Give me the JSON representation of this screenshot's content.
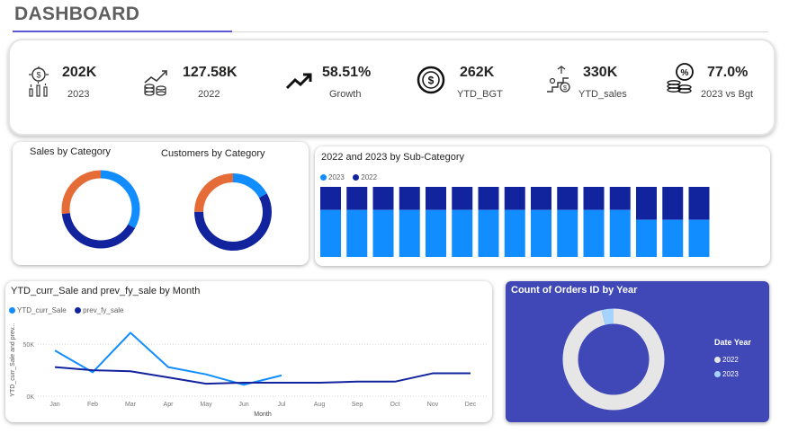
{
  "header": {
    "title": "DASHBOARD"
  },
  "kpis": [
    {
      "value": "202K",
      "label": "2023",
      "icon": "money-growth-icon"
    },
    {
      "value": "127.58K",
      "label": "2022",
      "icon": "coins-chart-icon"
    },
    {
      "value": "58.51%",
      "label": "Growth",
      "icon": "trend-up-arrow-icon"
    },
    {
      "value": "262K",
      "label": "YTD_BGT",
      "icon": "dollar-target-icon"
    },
    {
      "value": "330K",
      "label": "YTD_sales",
      "icon": "sales-steps-icon"
    },
    {
      "value": "77.0%",
      "label": "2023 vs Bgt",
      "icon": "percent-coins-icon"
    }
  ],
  "colors": {
    "series_2023": "#118dff",
    "series_2022": "#12239e",
    "orange": "#e66c37",
    "panel_blue": "#3f48b6",
    "ring_gray": "#e6e6e6",
    "ring_light_blue": "#a5d3ff"
  },
  "sales_by_category": {
    "title": "Sales by Category",
    "chart_data": {
      "type": "pie",
      "values": [
        0.33,
        0.4,
        0.27
      ],
      "colors": [
        "#118dff",
        "#12239e",
        "#e66c37"
      ]
    }
  },
  "customers_by_category": {
    "title": "Customers by Category",
    "chart_data": {
      "type": "pie",
      "values": [
        0.17,
        0.58,
        0.25
      ],
      "colors": [
        "#118dff",
        "#12239e",
        "#e66c37"
      ]
    }
  },
  "subcategory_chart": {
    "title": "2022 and 2023 by Sub-Category",
    "legend": [
      "2023",
      "2022"
    ],
    "chart_data": {
      "type": "bar",
      "stacked_100": true,
      "series": [
        {
          "name": "2023",
          "values": [
            0.67,
            0.67,
            0.67,
            0.67,
            0.67,
            0.67,
            0.67,
            0.67,
            0.67,
            0.67,
            0.67,
            0.67,
            0.53,
            0.53,
            0.53
          ]
        },
        {
          "name": "2022",
          "values": [
            0.33,
            0.33,
            0.33,
            0.33,
            0.33,
            0.33,
            0.33,
            0.33,
            0.33,
            0.33,
            0.33,
            0.33,
            0.47,
            0.47,
            0.47
          ]
        }
      ]
    }
  },
  "line_chart": {
    "title": "YTD_curr_Sale and prev_fy_sale by Month",
    "legend": [
      "YTD_curr_Sale",
      "prev_fy_sale"
    ],
    "chart_data": {
      "type": "line",
      "x": [
        "Jan",
        "Feb",
        "Mar",
        "Apr",
        "May",
        "Jun",
        "Jul",
        "Aug",
        "Sep",
        "Oct",
        "Nov",
        "Dec"
      ],
      "xlabel": "Month",
      "ylabel": "YTD_curr_Sale and prev...",
      "yticks": [
        "0K",
        "50K"
      ],
      "ylim": [
        0,
        70000
      ],
      "series": [
        {
          "name": "YTD_curr_Sale",
          "values": [
            44000,
            23000,
            61000,
            28000,
            21000,
            11000,
            20000,
            null,
            null,
            null,
            null,
            null
          ]
        },
        {
          "name": "prev_fy_sale",
          "values": [
            28000,
            25000,
            24000,
            18000,
            12000,
            13000,
            13000,
            13000,
            14000,
            14000,
            22000,
            22000
          ]
        }
      ]
    }
  },
  "orders_chart": {
    "title": "Count of Orders ID by Year",
    "legend_title": "Date Year",
    "legend": [
      "2022",
      "2023"
    ],
    "chart_data": {
      "type": "pie",
      "values": [
        0.96,
        0.04
      ],
      "colors": [
        "#e6e6e6",
        "#a5d3ff"
      ]
    }
  }
}
